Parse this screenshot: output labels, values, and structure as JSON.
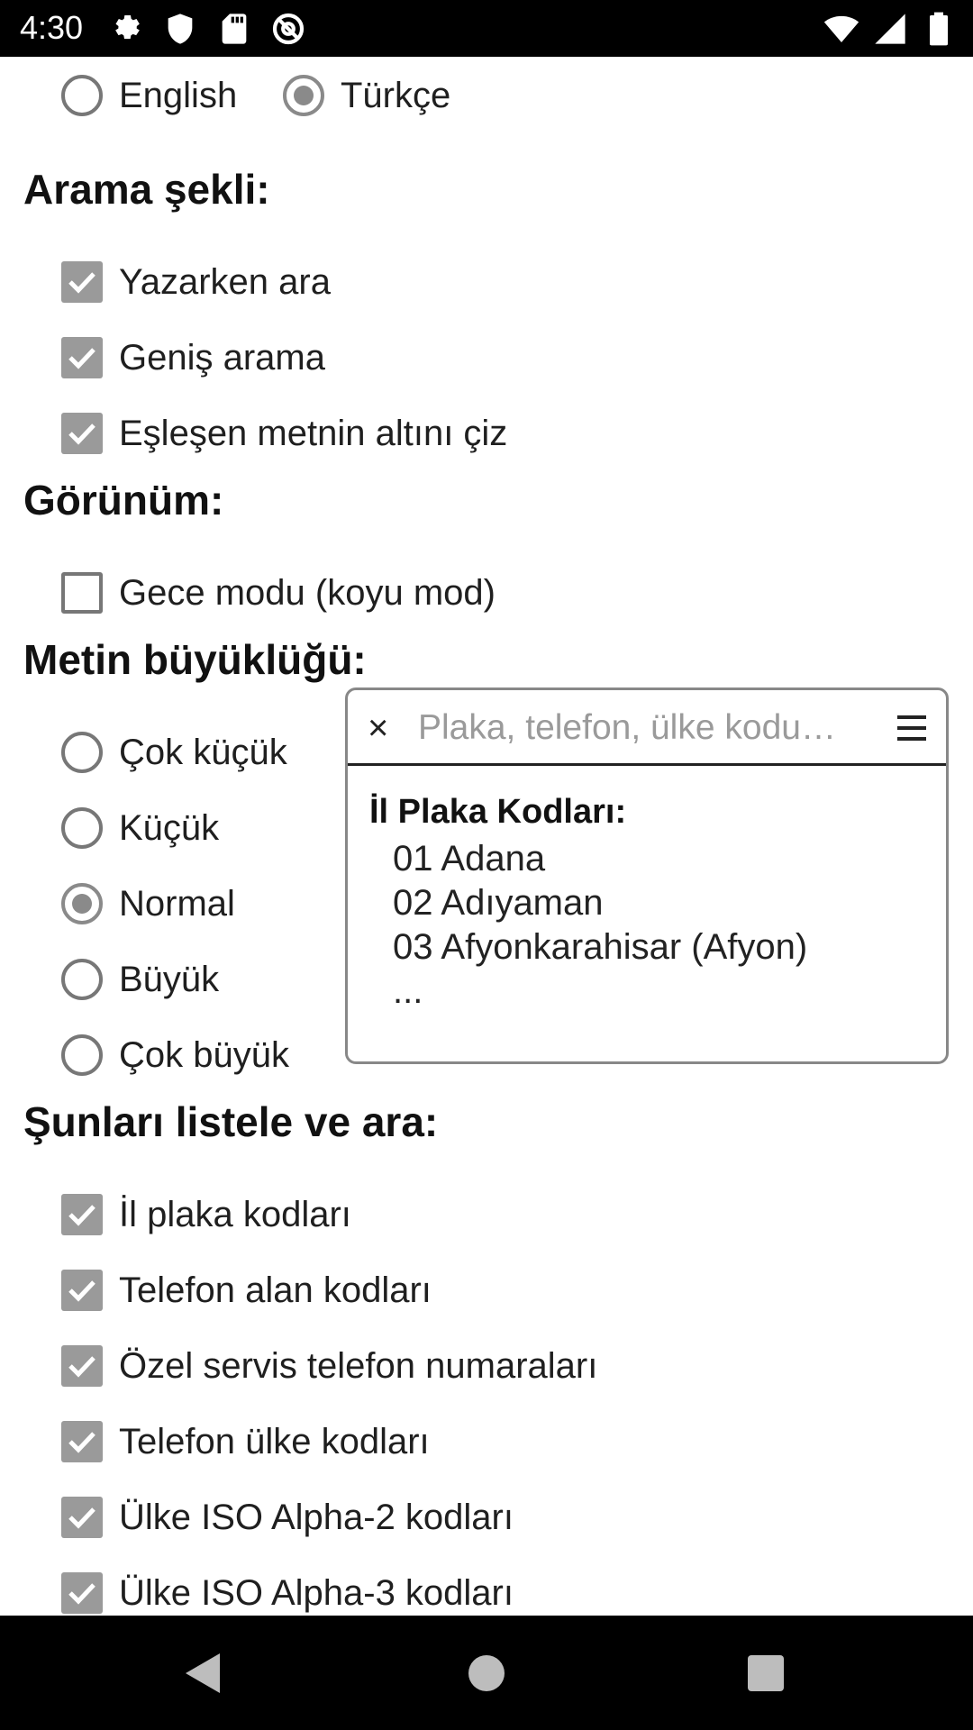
{
  "status_bar": {
    "time": "4:30",
    "left_icons": [
      "settings-icon",
      "shield-icon",
      "sd-card-icon",
      "at-sign-icon"
    ],
    "right_icons": [
      "wifi-icon",
      "signal-icon",
      "battery-icon"
    ]
  },
  "language": {
    "options": [
      {
        "label": "English",
        "checked": false
      },
      {
        "label": "Türkçe",
        "checked": true
      }
    ]
  },
  "search_mode": {
    "title": "Arama şekli:",
    "options": [
      {
        "label": "Yazarken ara",
        "checked": true
      },
      {
        "label": "Geniş arama",
        "checked": true
      },
      {
        "label": "Eşleşen metnin altını çiz",
        "checked": true
      }
    ]
  },
  "appearance": {
    "title": "Görünüm:",
    "options": [
      {
        "label": "Gece modu (koyu mod)",
        "checked": false
      }
    ]
  },
  "text_size": {
    "title": "Metin büyüklüğü:",
    "options": [
      {
        "label": "Çok küçük",
        "checked": false
      },
      {
        "label": "Küçük",
        "checked": false
      },
      {
        "label": "Normal",
        "checked": true
      },
      {
        "label": "Büyük",
        "checked": false
      },
      {
        "label": "Çok büyük",
        "checked": false
      }
    ]
  },
  "preview": {
    "close_symbol": "×",
    "search_placeholder": "Plaka, telefon, ülke kodu…",
    "heading": "İl Plaka Kodları:",
    "items": [
      "01 Adana",
      "02 Adıyaman",
      "03 Afyonkarahisar (Afyon)",
      "..."
    ]
  },
  "list_and_search": {
    "title": "Şunları listele ve ara:",
    "options": [
      {
        "label": "İl plaka kodları",
        "checked": true
      },
      {
        "label": "Telefon alan kodları",
        "checked": true
      },
      {
        "label": "Özel servis telefon numaraları",
        "checked": true
      },
      {
        "label": "Telefon ülke kodları",
        "checked": true
      },
      {
        "label": "Ülke ISO Alpha-2 kodları",
        "checked": true
      },
      {
        "label": "Ülke ISO Alpha-3 kodları",
        "checked": true
      }
    ]
  },
  "colors": {
    "bar_background": "#000000",
    "checked_box": "#9a9a9a",
    "control_border": "#777777"
  }
}
